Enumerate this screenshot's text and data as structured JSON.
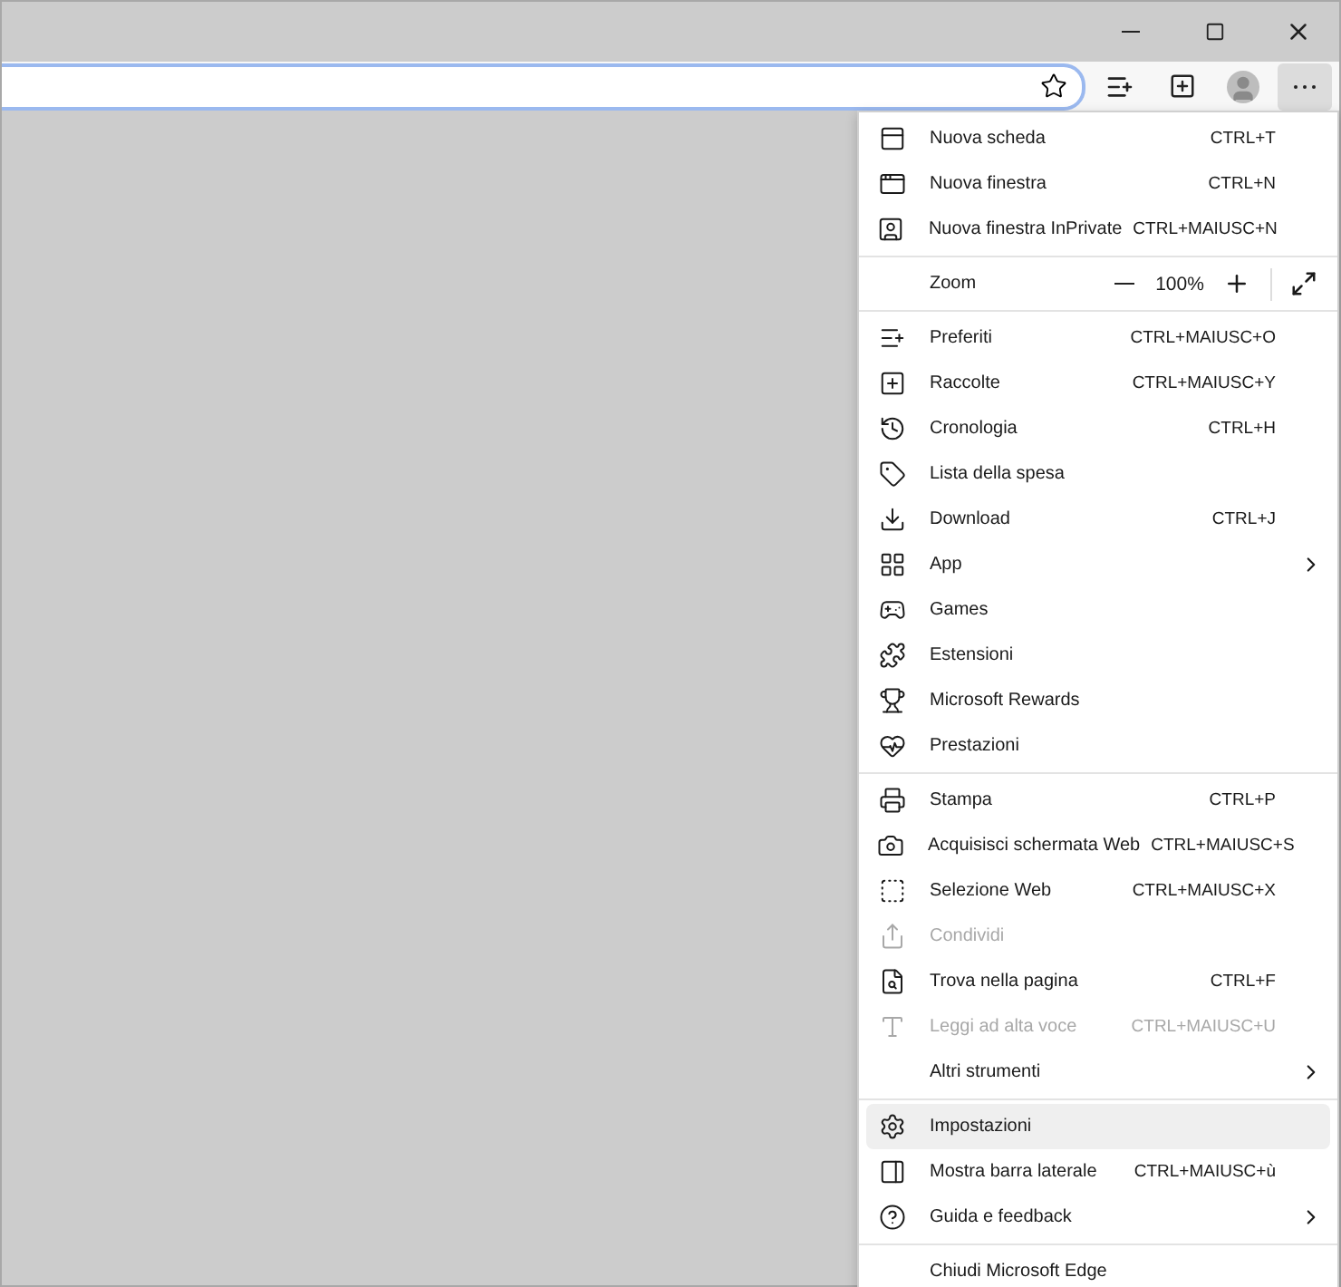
{
  "menu": {
    "sections": [
      {
        "kind": "list",
        "items": [
          {
            "label": "Nuova scheda",
            "shortcut": "CTRL+T",
            "disabled": false,
            "submenu": false,
            "hovered": false
          },
          {
            "label": "Nuova finestra",
            "shortcut": "CTRL+N",
            "disabled": false,
            "submenu": false,
            "hovered": false
          },
          {
            "label": "Nuova finestra InPrivate",
            "shortcut": "CTRL+MAIUSC+N",
            "disabled": false,
            "submenu": false,
            "hovered": false
          }
        ]
      },
      {
        "kind": "zoom",
        "label": "Zoom",
        "value": "100%"
      },
      {
        "kind": "list",
        "items": [
          {
            "label": "Preferiti",
            "shortcut": "CTRL+MAIUSC+O",
            "disabled": false,
            "submenu": false,
            "hovered": false
          },
          {
            "label": "Raccolte",
            "shortcut": "CTRL+MAIUSC+Y",
            "disabled": false,
            "submenu": false,
            "hovered": false
          },
          {
            "label": "Cronologia",
            "shortcut": "CTRL+H",
            "disabled": false,
            "submenu": false,
            "hovered": false
          },
          {
            "label": "Lista della spesa",
            "disabled": false,
            "submenu": false,
            "hovered": false
          },
          {
            "label": "Download",
            "shortcut": "CTRL+J",
            "disabled": false,
            "submenu": false,
            "hovered": false
          },
          {
            "label": "App",
            "disabled": false,
            "submenu": true,
            "hovered": false
          },
          {
            "label": "Games",
            "disabled": false,
            "submenu": false,
            "hovered": false
          },
          {
            "label": "Estensioni",
            "disabled": false,
            "submenu": false,
            "hovered": false
          },
          {
            "label": "Microsoft Rewards",
            "disabled": false,
            "submenu": false,
            "hovered": false
          },
          {
            "label": "Prestazioni",
            "disabled": false,
            "submenu": false,
            "hovered": false
          }
        ]
      },
      {
        "kind": "list",
        "items": [
          {
            "label": "Stampa",
            "shortcut": "CTRL+P",
            "disabled": false,
            "submenu": false,
            "hovered": false
          },
          {
            "label": "Acquisisci schermata Web",
            "shortcut": "CTRL+MAIUSC+S",
            "disabled": false,
            "submenu": false,
            "hovered": false
          },
          {
            "label": "Selezione Web",
            "shortcut": "CTRL+MAIUSC+X",
            "disabled": false,
            "submenu": false,
            "hovered": false
          },
          {
            "label": "Condividi",
            "disabled": true,
            "submenu": false,
            "hovered": false
          },
          {
            "label": "Trova nella pagina",
            "shortcut": "CTRL+F",
            "disabled": false,
            "submenu": false,
            "hovered": false
          },
          {
            "label": "Leggi ad alta voce",
            "shortcut": "CTRL+MAIUSC+U",
            "disabled": true,
            "submenu": false,
            "hovered": false
          },
          {
            "label": "Altri strumenti",
            "disabled": false,
            "submenu": true,
            "hovered": false
          }
        ]
      },
      {
        "kind": "list",
        "items": [
          {
            "label": "Impostazioni",
            "disabled": false,
            "submenu": false,
            "hovered": true
          },
          {
            "label": "Mostra barra laterale",
            "shortcut": "CTRL+MAIUSC+ù",
            "disabled": false,
            "submenu": false,
            "hovered": false
          },
          {
            "label": "Guida e feedback",
            "disabled": false,
            "submenu": true,
            "hovered": false
          }
        ]
      },
      {
        "kind": "list",
        "items": [
          {
            "label": "Chiudi Microsoft Edge",
            "disabled": false,
            "submenu": false,
            "hovered": false
          }
        ]
      }
    ]
  }
}
